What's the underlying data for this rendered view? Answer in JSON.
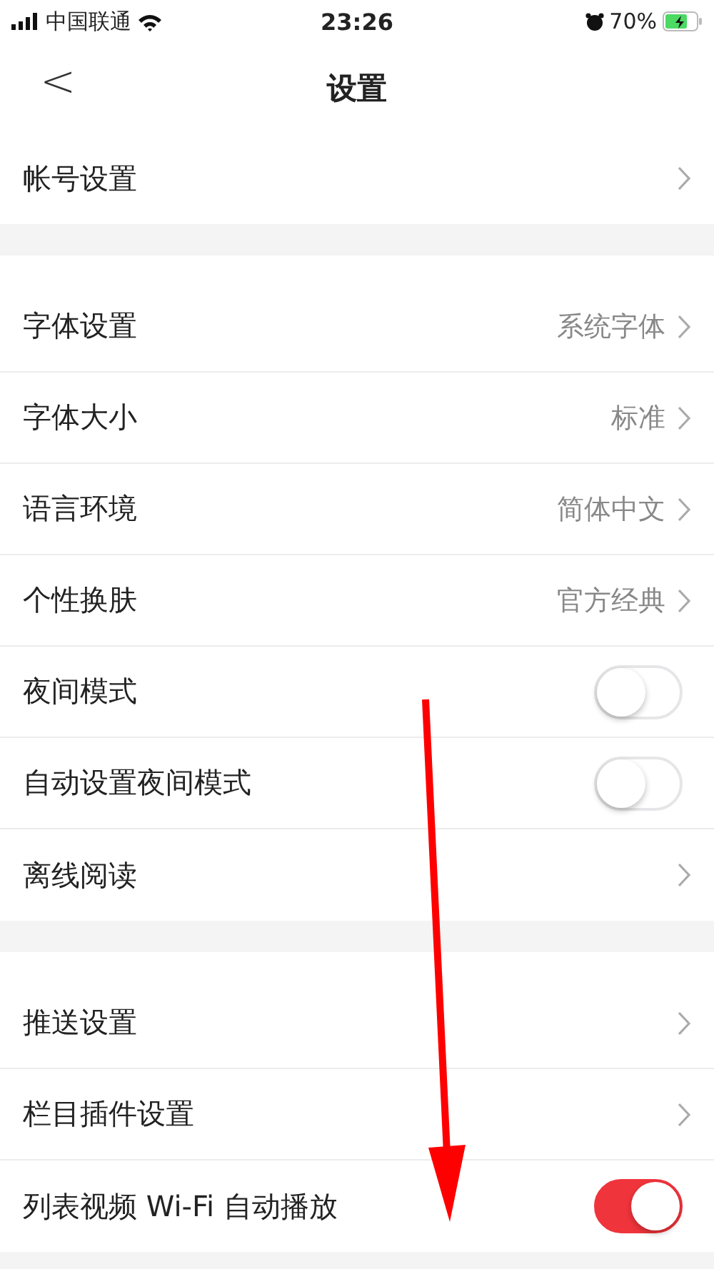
{
  "status_bar": {
    "carrier": "中国联通",
    "time": "23:26",
    "battery": "70%"
  },
  "nav": {
    "back": "<",
    "title": "设置"
  },
  "groups": [
    {
      "rows": [
        {
          "kind": "link",
          "label": "帐号设置"
        }
      ]
    },
    {
      "rows": [
        {
          "kind": "link",
          "label": "字体设置",
          "value": "系统字体"
        },
        {
          "kind": "link",
          "label": "字体大小",
          "value": "标准"
        },
        {
          "kind": "link",
          "label": "语言环境",
          "value": "简体中文"
        },
        {
          "kind": "link",
          "label": "个性换肤",
          "value": "官方经典"
        },
        {
          "kind": "toggle",
          "label": "夜间模式",
          "on": false
        },
        {
          "kind": "toggle",
          "label": "自动设置夜间模式",
          "on": false
        },
        {
          "kind": "link",
          "label": "离线阅读"
        }
      ]
    },
    {
      "rows": [
        {
          "kind": "link",
          "label": "推送设置"
        },
        {
          "kind": "link",
          "label": "栏目插件设置"
        },
        {
          "kind": "toggle",
          "label": "列表视频 Wi-Fi 自动播放",
          "on": true
        }
      ]
    }
  ]
}
